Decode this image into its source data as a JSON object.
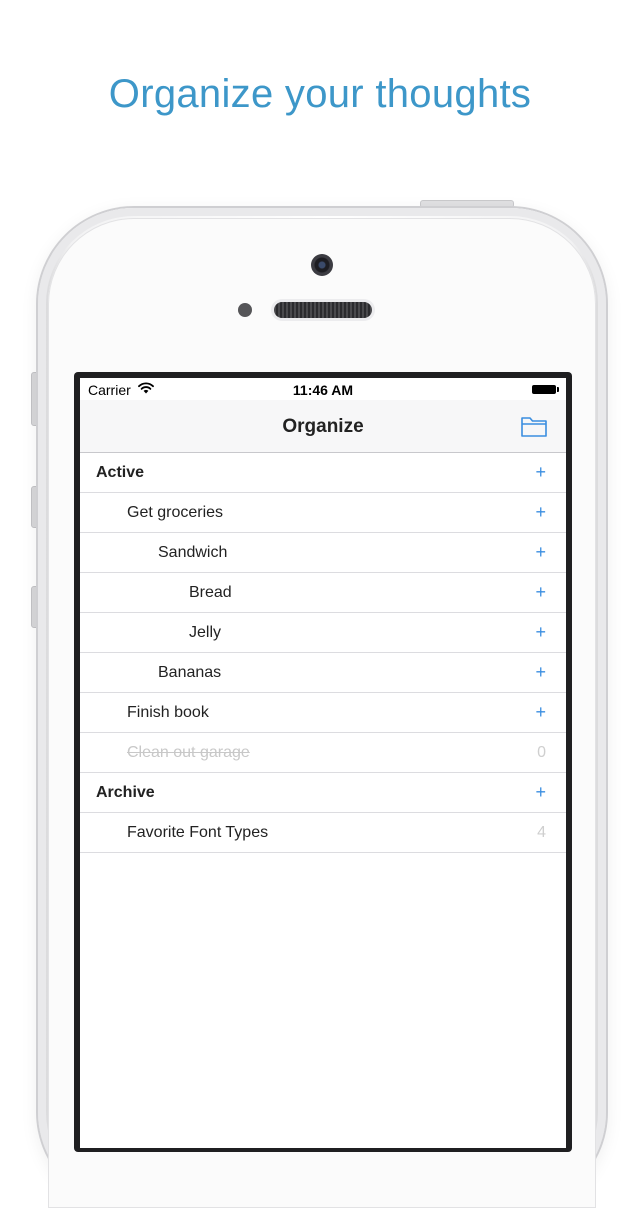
{
  "headline": "Organize your thoughts",
  "status_bar": {
    "carrier": "Carrier",
    "time": "11:46 AM"
  },
  "nav": {
    "title": "Organize",
    "folder_icon": "folder-icon"
  },
  "accent_color": "#3a8ee0",
  "rows": [
    {
      "label": "Active",
      "level": 0,
      "section": true,
      "done": false,
      "action": "+"
    },
    {
      "label": "Get groceries",
      "level": 1,
      "section": false,
      "done": false,
      "action": "+"
    },
    {
      "label": "Sandwich",
      "level": 2,
      "section": false,
      "done": false,
      "action": "+"
    },
    {
      "label": "Bread",
      "level": 3,
      "section": false,
      "done": false,
      "action": "+"
    },
    {
      "label": "Jelly",
      "level": 3,
      "section": false,
      "done": false,
      "action": "+"
    },
    {
      "label": "Bananas",
      "level": 2,
      "section": false,
      "done": false,
      "action": "+"
    },
    {
      "label": "Finish book",
      "level": 1,
      "section": false,
      "done": false,
      "action": "+"
    },
    {
      "label": "Clean out garage",
      "level": 1,
      "section": false,
      "done": true,
      "action": "0"
    },
    {
      "label": "Archive",
      "level": 0,
      "section": true,
      "done": false,
      "action": "+"
    },
    {
      "label": "Favorite Font Types",
      "level": 1,
      "section": false,
      "done": false,
      "action": "4"
    }
  ]
}
